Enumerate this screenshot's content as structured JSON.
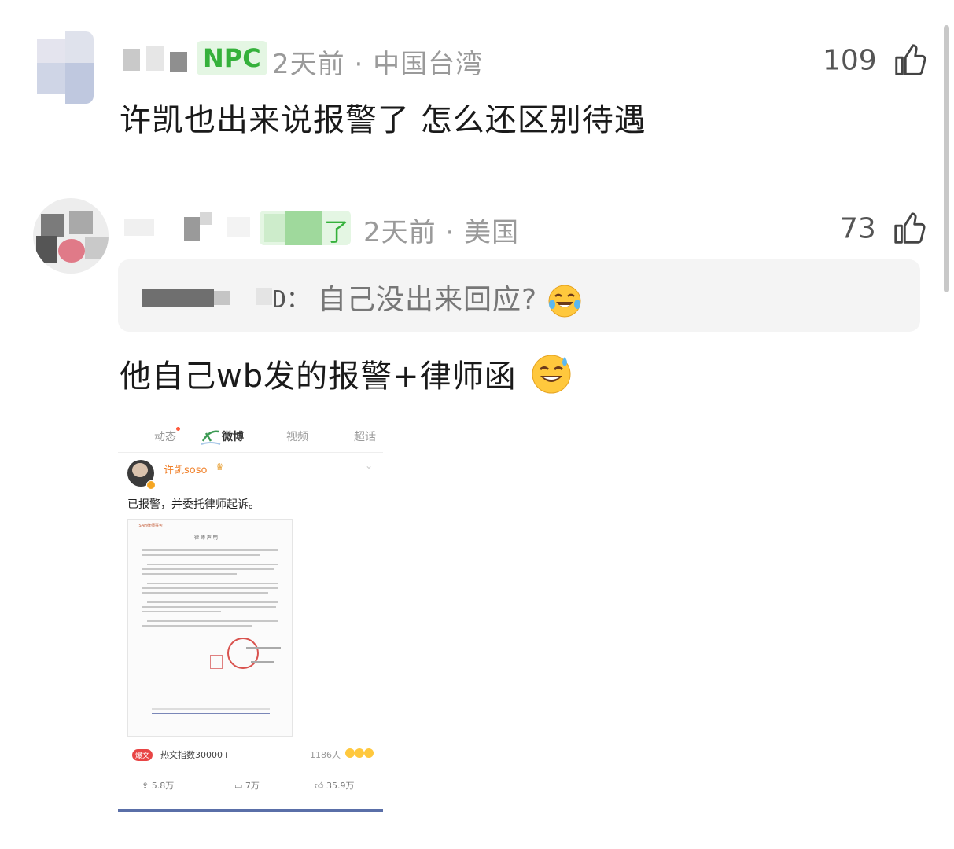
{
  "comments": [
    {
      "badge": "NPC",
      "time": "2天前",
      "location": "中国台湾",
      "likes": "109",
      "text": "许凯也出来说报警了 怎么还区别待遇"
    },
    {
      "badge_char": "了",
      "time": "2天前",
      "location": "美国",
      "likes": "73",
      "quote_suffix": "D：",
      "quote_text": "自己没出来回应?",
      "text": "他自己wb发的报警+律师函"
    }
  ],
  "separator": "·",
  "embedded_post": {
    "tabs": [
      "动态",
      "微博",
      "视频",
      "超话"
    ],
    "active_tab": "微博",
    "user_name": "许凯soso",
    "post_text": "已报警，并委托律师起诉。",
    "doc_header": "ISAH律师事务",
    "doc_title": "律 师 声 明",
    "hot_badge": "爆文",
    "hot_index": "热文指数30000+",
    "reactions_count": "1186人",
    "reposts": "5.8万",
    "comments": "7万",
    "likes": "35.9万"
  },
  "colors": {
    "npc_green": "#35b13b",
    "npc_bg": "#e4f6e3",
    "meta_gray": "#9a9a9a",
    "quote_bg": "#f4f4f4"
  },
  "icons": [
    "thumb-up-icon",
    "laughing-emoji-icon",
    "sweat-smile-emoji-icon"
  ]
}
